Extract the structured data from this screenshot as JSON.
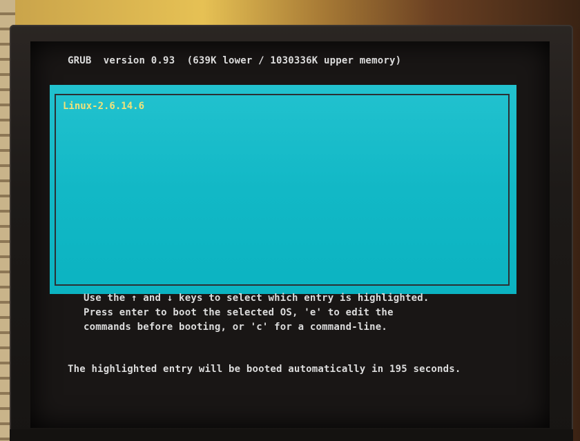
{
  "grub": {
    "header": "GRUB  version 0.93  (639K lower / 1030336K upper memory)",
    "entries": [
      {
        "label": "Linux-2.6.14.6",
        "selected": true
      }
    ],
    "help_lines": [
      "Use the ↑ and ↓ keys to select which entry is highlighted.",
      "Press enter to boot the selected OS, 'e' to edit the",
      "commands before booting, or 'c' for a command-line."
    ],
    "countdown": "The highlighted entry will be booted automatically in 195 seconds."
  },
  "colors": {
    "menu_background": "#12b8c6",
    "entry_text": "#f0e27a",
    "screen_background": "#191615",
    "terminal_text": "#dcdcdc"
  }
}
